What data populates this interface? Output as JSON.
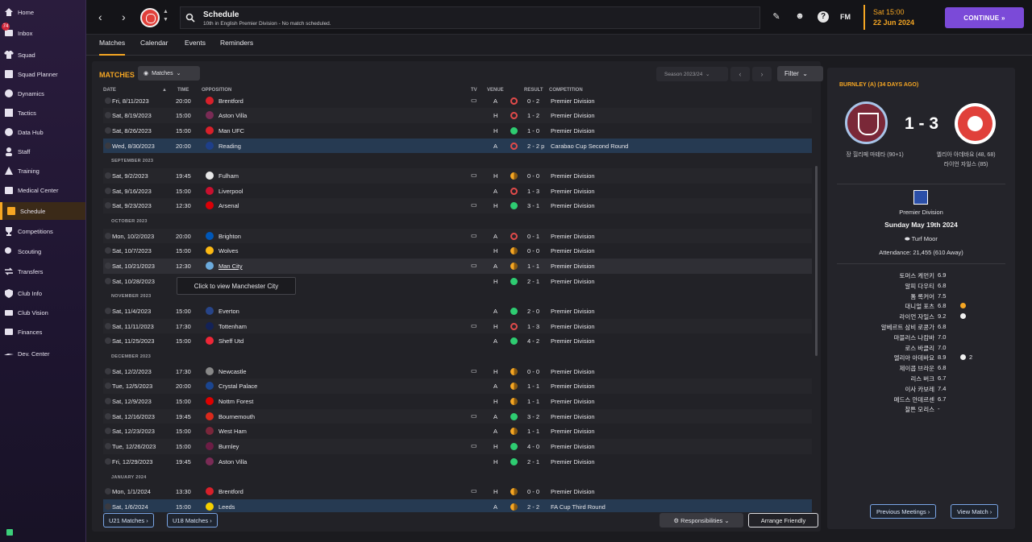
{
  "sidebar": {
    "inbox_badge": "74",
    "items": [
      {
        "label": "Home",
        "icon": "home-icon"
      },
      {
        "label": "Inbox",
        "icon": "inbox-icon"
      },
      {
        "label": "Squad",
        "icon": "shirt-icon"
      },
      {
        "label": "Squad Planner",
        "icon": "planner-icon"
      },
      {
        "label": "Dynamics",
        "icon": "dynamics-icon"
      },
      {
        "label": "Tactics",
        "icon": "tactics-icon"
      },
      {
        "label": "Data Hub",
        "icon": "data-hub-icon"
      },
      {
        "label": "Staff",
        "icon": "staff-icon"
      },
      {
        "label": "Training",
        "icon": "training-icon"
      },
      {
        "label": "Medical Center",
        "icon": "medical-icon"
      },
      {
        "label": "Schedule",
        "icon": "calendar-icon"
      },
      {
        "label": "Competitions",
        "icon": "trophy-icon"
      },
      {
        "label": "Scouting",
        "icon": "scouting-icon"
      },
      {
        "label": "Transfers",
        "icon": "transfers-icon"
      },
      {
        "label": "Club Info",
        "icon": "shield-icon"
      },
      {
        "label": "Club Vision",
        "icon": "vision-icon"
      },
      {
        "label": "Finances",
        "icon": "finances-icon"
      },
      {
        "label": "Dev. Center",
        "icon": "dev-center-icon"
      }
    ]
  },
  "topbar": {
    "title": "Schedule",
    "subtitle": "10th in English Premier Division - No match scheduled.",
    "fm_logo": "FM",
    "time": "Sat 15:00",
    "date": "22 Jun 2024",
    "continue_label": "CONTINUE"
  },
  "tabs": [
    "Matches",
    "Calendar",
    "Events",
    "Reminders"
  ],
  "main": {
    "title": "MATCHES",
    "view_label": "Matches",
    "season_label": "Season 2023/24",
    "filter_label": "Filter",
    "columns": {
      "date": "DATE",
      "time": "TIME",
      "opposition": "OPPOSITION",
      "tv": "TV",
      "venue": "VENUE",
      "result": "RESULT",
      "competition": "COMPETITION"
    },
    "rows": [
      {
        "kind": "match",
        "date": "Fri, 8/11/2023",
        "time": "20:00",
        "opp": "Brentford",
        "tv": true,
        "venue": "A",
        "res": "L",
        "score": "0 - 2",
        "comp": "Premier Division",
        "crest": "#d8202a"
      },
      {
        "kind": "match",
        "date": "Sat, 8/19/2023",
        "time": "15:00",
        "opp": "Aston Villa",
        "tv": false,
        "venue": "H",
        "res": "L",
        "score": "1 - 2",
        "comp": "Premier Division",
        "crest": "#7a2b55"
      },
      {
        "kind": "match",
        "date": "Sat, 8/26/2023",
        "time": "15:00",
        "opp": "Man UFC",
        "tv": false,
        "venue": "H",
        "res": "W",
        "score": "1 - 0",
        "comp": "Premier Division",
        "crest": "#d8202a"
      },
      {
        "kind": "match",
        "date": "Wed, 8/30/2023",
        "time": "20:00",
        "opp": "Reading",
        "tv": false,
        "venue": "A",
        "res": "L",
        "score": "2 - 2 p",
        "comp": "Carabao Cup Second Round",
        "crest": "#1e3f8a",
        "hl": true
      },
      {
        "kind": "month",
        "label": "SEPTEMBER 2023"
      },
      {
        "kind": "match",
        "date": "Sat, 9/2/2023",
        "time": "19:45",
        "opp": "Fulham",
        "tv": true,
        "venue": "H",
        "res": "D",
        "score": "0 - 0",
        "comp": "Premier Division",
        "crest": "#e8e8e8"
      },
      {
        "kind": "match",
        "date": "Sat, 9/16/2023",
        "time": "15:00",
        "opp": "Liverpool",
        "tv": false,
        "venue": "A",
        "res": "L",
        "score": "1 - 3",
        "comp": "Premier Division",
        "crest": "#c8102e"
      },
      {
        "kind": "match",
        "date": "Sat, 9/23/2023",
        "time": "12:30",
        "opp": "Arsenal",
        "tv": true,
        "venue": "H",
        "res": "W",
        "score": "3 - 1",
        "comp": "Premier Division",
        "crest": "#db0007"
      },
      {
        "kind": "month",
        "label": "OCTOBER 2023"
      },
      {
        "kind": "match",
        "date": "Mon, 10/2/2023",
        "time": "20:00",
        "opp": "Brighton",
        "tv": true,
        "venue": "A",
        "res": "L",
        "score": "0 - 1",
        "comp": "Premier Division",
        "crest": "#0057b8"
      },
      {
        "kind": "match",
        "date": "Sat, 10/7/2023",
        "time": "15:00",
        "opp": "Wolves",
        "tv": false,
        "venue": "H",
        "res": "D",
        "score": "0 - 0",
        "comp": "Premier Division",
        "crest": "#fdb913"
      },
      {
        "kind": "match",
        "date": "Sat, 10/21/2023",
        "time": "12:30",
        "opp": "Man City",
        "tv": true,
        "venue": "A",
        "res": "D",
        "score": "1 - 1",
        "comp": "Premier Division",
        "crest": "#6cabdd",
        "sel": true
      },
      {
        "kind": "match",
        "date": "Sat, 10/28/2023",
        "time": "",
        "opp": "",
        "tv": false,
        "venue": "H",
        "res": "W",
        "score": "2 - 1",
        "comp": "Premier Division",
        "crest": "#444"
      },
      {
        "kind": "month",
        "label": "NOVEMBER 2023"
      },
      {
        "kind": "match",
        "date": "Sat, 11/4/2023",
        "time": "15:00",
        "opp": "Everton",
        "tv": false,
        "venue": "A",
        "res": "W",
        "score": "2 - 0",
        "comp": "Premier Division",
        "crest": "#274488"
      },
      {
        "kind": "match",
        "date": "Sat, 11/11/2023",
        "time": "17:30",
        "opp": "Tottenham",
        "tv": true,
        "venue": "H",
        "res": "L",
        "score": "1 - 3",
        "comp": "Premier Division",
        "crest": "#132257"
      },
      {
        "kind": "match",
        "date": "Sat, 11/25/2023",
        "time": "15:00",
        "opp": "Sheff Utd",
        "tv": false,
        "venue": "A",
        "res": "W",
        "score": "4 - 2",
        "comp": "Premier Division",
        "crest": "#ee2737"
      },
      {
        "kind": "month",
        "label": "DECEMBER 2023"
      },
      {
        "kind": "match",
        "date": "Sat, 12/2/2023",
        "time": "17:30",
        "opp": "Newcastle",
        "tv": true,
        "venue": "H",
        "res": "D",
        "score": "0 - 0",
        "comp": "Premier Division",
        "crest": "#888"
      },
      {
        "kind": "match",
        "date": "Tue, 12/5/2023",
        "time": "20:00",
        "opp": "Crystal Palace",
        "tv": false,
        "venue": "A",
        "res": "D",
        "score": "1 - 1",
        "comp": "Premier Division",
        "crest": "#1b458f"
      },
      {
        "kind": "match",
        "date": "Sat, 12/9/2023",
        "time": "15:00",
        "opp": "Nottm Forest",
        "tv": false,
        "venue": "H",
        "res": "D",
        "score": "1 - 1",
        "comp": "Premier Division",
        "crest": "#dd0000"
      },
      {
        "kind": "match",
        "date": "Sat, 12/16/2023",
        "time": "19:45",
        "opp": "Bournemouth",
        "tv": true,
        "venue": "A",
        "res": "W",
        "score": "3 - 2",
        "comp": "Premier Division",
        "crest": "#da291c"
      },
      {
        "kind": "match",
        "date": "Sat, 12/23/2023",
        "time": "15:00",
        "opp": "West Ham",
        "tv": false,
        "venue": "A",
        "res": "D",
        "score": "1 - 1",
        "comp": "Premier Division",
        "crest": "#7a263a"
      },
      {
        "kind": "match",
        "date": "Tue, 12/26/2023",
        "time": "15:00",
        "opp": "Burnley",
        "tv": true,
        "venue": "H",
        "res": "W",
        "score": "4 - 0",
        "comp": "Premier Division",
        "crest": "#6c1d45"
      },
      {
        "kind": "match",
        "date": "Fri, 12/29/2023",
        "time": "19:45",
        "opp": "Aston Villa",
        "tv": false,
        "venue": "H",
        "res": "W",
        "score": "2 - 1",
        "comp": "Premier Division",
        "crest": "#7a2b55"
      },
      {
        "kind": "month",
        "label": "JANUARY 2024"
      },
      {
        "kind": "match",
        "date": "Mon, 1/1/2024",
        "time": "13:30",
        "opp": "Brentford",
        "tv": true,
        "venue": "H",
        "res": "D",
        "score": "0 - 0",
        "comp": "Premier Division",
        "crest": "#d8202a"
      },
      {
        "kind": "match",
        "date": "Sat, 1/6/2024",
        "time": "15:00",
        "opp": "Leeds",
        "tv": false,
        "venue": "A",
        "res": "D",
        "score": "2 - 2",
        "comp": "FA Cup Third Round",
        "crest": "#f5d000",
        "hl": true
      }
    ],
    "tooltip": "Click to view Manchester City",
    "u21_label": "U21 Matches",
    "u18_label": "U18 Matches",
    "responsibilities_label": "Responsibilities",
    "arrange_label": "Arrange Friendly"
  },
  "match_panel": {
    "title": "BURNLEY (A) (34 DAYS AGO)",
    "score": "1 - 3",
    "home_scorer": "장 힐리페 마테타 (90+1)",
    "away_scorer_1": "엘리아 아데바요 (48, 68)",
    "away_scorer_2": "라이언 자일스 (85)",
    "competition": "Premier Division",
    "date": "Sunday May 19th 2024",
    "venue": "Turf Moor",
    "attendance": "Attendance: 21,455 (610 Away)",
    "ratings": [
      {
        "name": "토머스 케먼키",
        "rating": "6.9",
        "event": ""
      },
      {
        "name": "알피 다우티",
        "rating": "6.8",
        "event": ""
      },
      {
        "name": "톰 록커어",
        "rating": "7.5",
        "event": ""
      },
      {
        "name": "대니얼 포츠",
        "rating": "6.8",
        "event": "star"
      },
      {
        "name": "라이언 자일스",
        "rating": "9.2",
        "event": "ball"
      },
      {
        "name": "알베르트 삼비 로콩가",
        "rating": "6.8",
        "event": ""
      },
      {
        "name": "마블러스 나캄바",
        "rating": "7.0",
        "event": ""
      },
      {
        "name": "로스 바클리",
        "rating": "7.0",
        "event": ""
      },
      {
        "name": "엘리아 아데바요",
        "rating": "8.9",
        "event": "ball",
        "count": "2"
      },
      {
        "name": "제이콥 브라운",
        "rating": "6.8",
        "event": ""
      },
      {
        "name": "리스 버크",
        "rating": "6.7",
        "event": ""
      },
      {
        "name": "이사 카보레",
        "rating": "7.4",
        "event": ""
      },
      {
        "name": "메드스 안데르센",
        "rating": "6.7",
        "event": ""
      },
      {
        "name": "찰튼 모리스",
        "rating": "-",
        "event": ""
      }
    ],
    "prev_meetings_label": "Previous Meetings",
    "view_match_label": "View Match"
  },
  "colors": {
    "accent": "#f5a623",
    "continue": "#7b4ad8",
    "win": "#2ecc71",
    "loss": "#e04a4a",
    "highlight_row": "#263a52"
  }
}
